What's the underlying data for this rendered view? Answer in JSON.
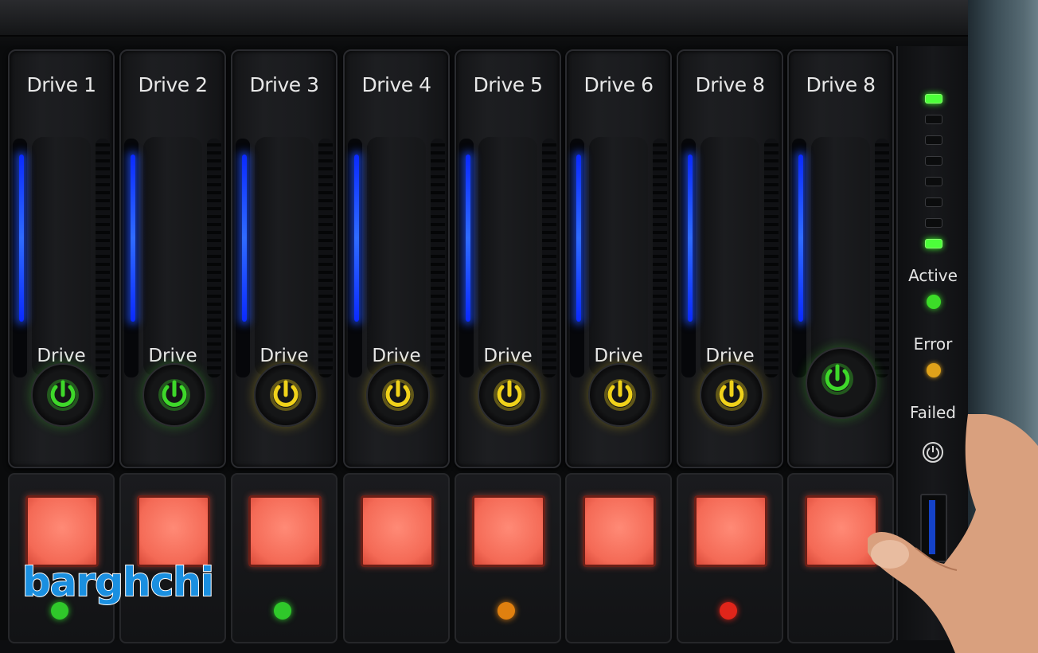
{
  "bays": [
    {
      "label": "Drive 1",
      "caption": "Drive",
      "power_color": "#3ed82a",
      "indicator": "#2fc82a"
    },
    {
      "label": "Drive 2",
      "caption": "Drive",
      "power_color": "#3ed82a",
      "indicator": null
    },
    {
      "label": "Drive 3",
      "caption": "Drive",
      "power_color": "#f0d21a",
      "indicator": "#2fc82a"
    },
    {
      "label": "Drive 4",
      "caption": "Drive",
      "power_color": "#f0d21a",
      "indicator": null
    },
    {
      "label": "Drive 5",
      "caption": "Drive",
      "power_color": "#f0d21a",
      "indicator": "#e0800f"
    },
    {
      "label": "Drive 6",
      "caption": "Drive",
      "power_color": "#f0d21a",
      "indicator": null
    },
    {
      "label": "Drive 8",
      "caption": "Drive",
      "power_color": "#f0d21a",
      "indicator": "#e0251a"
    },
    {
      "label": "Drive 8",
      "caption": "",
      "power_color": "#3ed82a",
      "indicator": null
    }
  ],
  "status_panel": {
    "active_label": "Active",
    "error_label": "Error",
    "failed_label": "Failed",
    "active_color": "#3cdc28",
    "error_color": "#e0a21a"
  },
  "watermark": "barghchi"
}
